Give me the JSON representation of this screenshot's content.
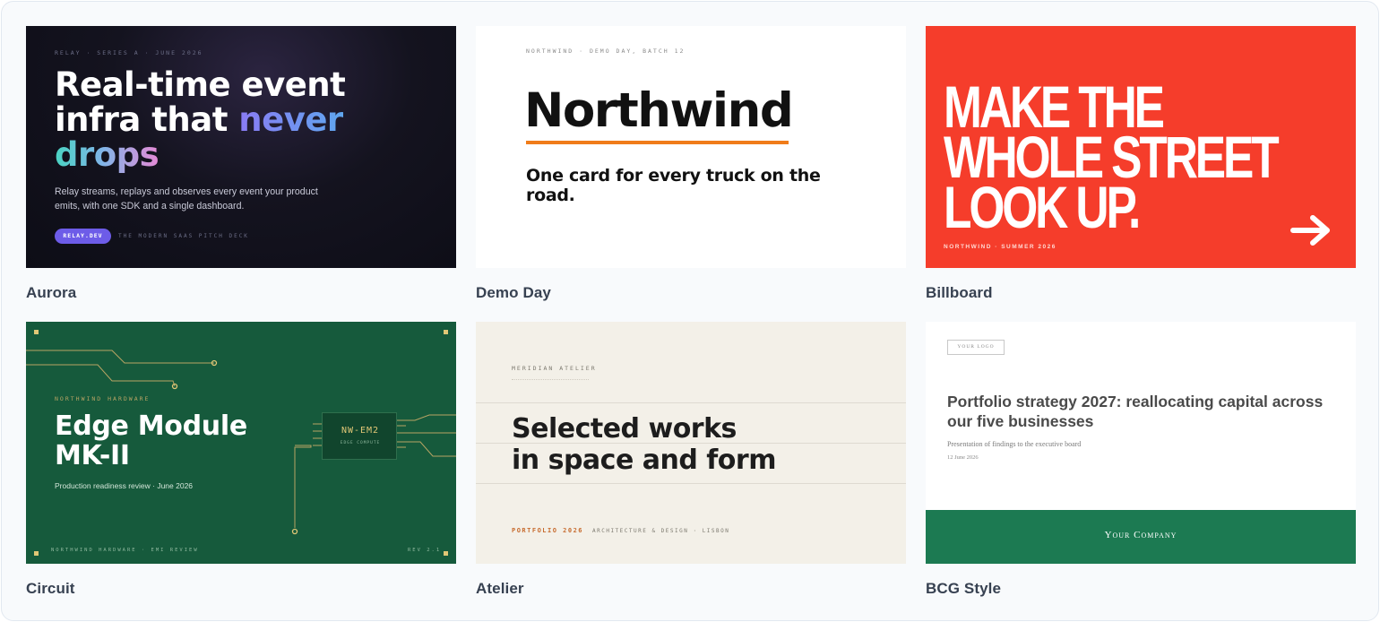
{
  "templates": [
    {
      "label": "Aurora",
      "eyebrow": "RELAY · SERIES A · JUNE 2026",
      "headline_line1": "Real-time event",
      "headline_line2_plain": "infra that ",
      "headline_line2_accent": "never",
      "headline_line3_accent": "drops",
      "body": "Relay streams, replays and observes every event your product emits, with one SDK and a single dashboard.",
      "pill": "RELAY.DEV",
      "tagline": "THE MODERN SAAS PITCH DECK"
    },
    {
      "label": "Demo Day",
      "eyebrow": "NORTHWIND · DEMO DAY, BATCH 12",
      "title": "Northwind",
      "subtitle": "One card for every truck on the road."
    },
    {
      "label": "Billboard",
      "headline_line1": "MAKE THE",
      "headline_line2": "WHOLE STREET",
      "headline_line3": "LOOK UP.",
      "footer": "NORTHWIND · SUMMER 2026"
    },
    {
      "label": "Circuit",
      "eyebrow": "NORTHWIND HARDWARE",
      "title_line1": "Edge Module",
      "title_line2": "MK-II",
      "subtitle": "Production readiness review · June 2026",
      "chip_name": "NW-EM2",
      "chip_sub": "EDGE COMPUTE",
      "footer_left": "NORTHWIND HARDWARE · EMI REVIEW",
      "footer_right": "REV 2.1"
    },
    {
      "label": "Atelier",
      "eyebrow": "MERIDIAN ATELIER",
      "title_line1": "Selected works",
      "title_line2": "in space and form",
      "footer_accent": "PORTFOLIO 2026",
      "footer": "ARCHITECTURE & DESIGN · LISBON"
    },
    {
      "label": "BCG Style",
      "logo": "YOUR LOGO",
      "title": "Portfolio strategy 2027: reallocating capital across our five businesses",
      "subtitle": "Presentation of findings to the executive board",
      "date": "12 June 2026",
      "company": "Your Company"
    }
  ],
  "colors": {
    "aurora_accent": "#6d5ce8",
    "demoday_accent": "#f07c1a",
    "billboard_bg": "#f53d2b",
    "circuit_bg": "#165a3c",
    "atelier_accent": "#c76b2e",
    "bcg_band": "#1c7a52"
  },
  "icons": {
    "billboard": "arrow-right-icon",
    "circuit": "pcb-traces-icon"
  }
}
